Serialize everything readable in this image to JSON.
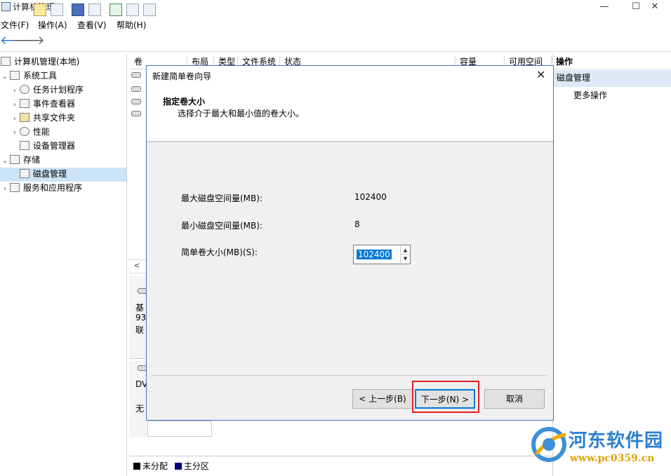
{
  "window": {
    "title": "计算机管理",
    "min": "—",
    "max": "☐",
    "close": "✕"
  },
  "menu": [
    "文件(F)",
    "操作(A)",
    "查看(V)",
    "帮助(H)"
  ],
  "toolbar": {
    "back": "🡐",
    "forward": "🡒"
  },
  "tree": {
    "root": "计算机管理(本地)",
    "system_tools": "系统工具",
    "task_scheduler": "任务计划程序",
    "event_viewer": "事件查看器",
    "shared_folders": "共享文件夹",
    "performance": "性能",
    "device_manager": "设备管理器",
    "storage": "存储",
    "disk_management": "磁盘管理",
    "services": "服务和应用程序"
  },
  "columns": [
    "卷",
    "布局",
    "类型",
    "文件系统",
    "状态",
    "容量",
    "可用空间"
  ],
  "lower_panel": {
    "disk0_line1": "基",
    "disk0_line2": "93",
    "disk0_line3": "联",
    "dvd_line1": "DV",
    "dvd_line2": "无"
  },
  "legend": {
    "unallocated": "未分配",
    "primary": "主分区",
    "unallocated_color": "#000000",
    "primary_color": "#000080"
  },
  "actions": {
    "header": "操作",
    "selected": "磁盘管理",
    "more": "更多操作"
  },
  "dialog": {
    "title": "新建简单卷向导",
    "close": "✕",
    "heading": "指定卷大小",
    "subheading": "选择介于最大和最小值的卷大小。",
    "max_label": "最大磁盘空间量(MB):",
    "max_value": "102400",
    "min_label": "最小磁盘空间量(MB):",
    "min_value": "8",
    "size_label": "简单卷大小(MB)(S):",
    "size_value": "102400",
    "back_button": "< 上一步(B)",
    "next_button": "下一步(N) >",
    "cancel_button": "取消"
  },
  "watermark": {
    "name": "河东软件园",
    "url": "www.pc0359.cn"
  }
}
